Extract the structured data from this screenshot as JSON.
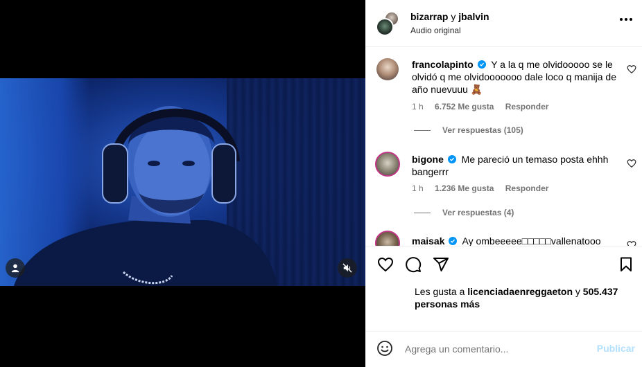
{
  "post": {
    "users": [
      "bizarrap",
      "jbalvin"
    ],
    "users_sep": "y",
    "audio": "Audio original"
  },
  "comments": [
    {
      "username": "francolapinto",
      "verified": true,
      "text": "Y a la q me olvidooooo se le olvidó q me olvidooooooo dale loco q manija de año nuevuuu 🧸",
      "time": "1 h",
      "likes": "6.752 Me gusta",
      "reply": "Responder",
      "view_replies": "Ver respuestas (105)"
    },
    {
      "username": "bigone",
      "verified": true,
      "text": "Me pareció un temaso posta ehhh bangerrr",
      "time": "1 h",
      "likes": "1.236 Me gusta",
      "reply": "Responder",
      "view_replies": "Ver respuestas (4)"
    },
    {
      "username": "maisak",
      "verified": true,
      "text": "Ay ombeeeee□□□□□vallenatooo"
    }
  ],
  "likes": {
    "prefix": "Les gusta a",
    "user": "licenciadaenreggaeton",
    "and": "y",
    "count": "505.437",
    "suffix": "personas más"
  },
  "compose": {
    "placeholder": "Agrega un comentario...",
    "publish": "Publicar"
  },
  "colors": {
    "verified": "#0095f6",
    "publish_disabled": "#b2dffc",
    "secondary_text": "#737373"
  },
  "icons": [
    "user-icon",
    "muted-speaker-icon",
    "more-options-icon",
    "heart-icon",
    "comment-icon",
    "share-icon",
    "bookmark-icon",
    "emoji-icon",
    "verified-icon"
  ]
}
